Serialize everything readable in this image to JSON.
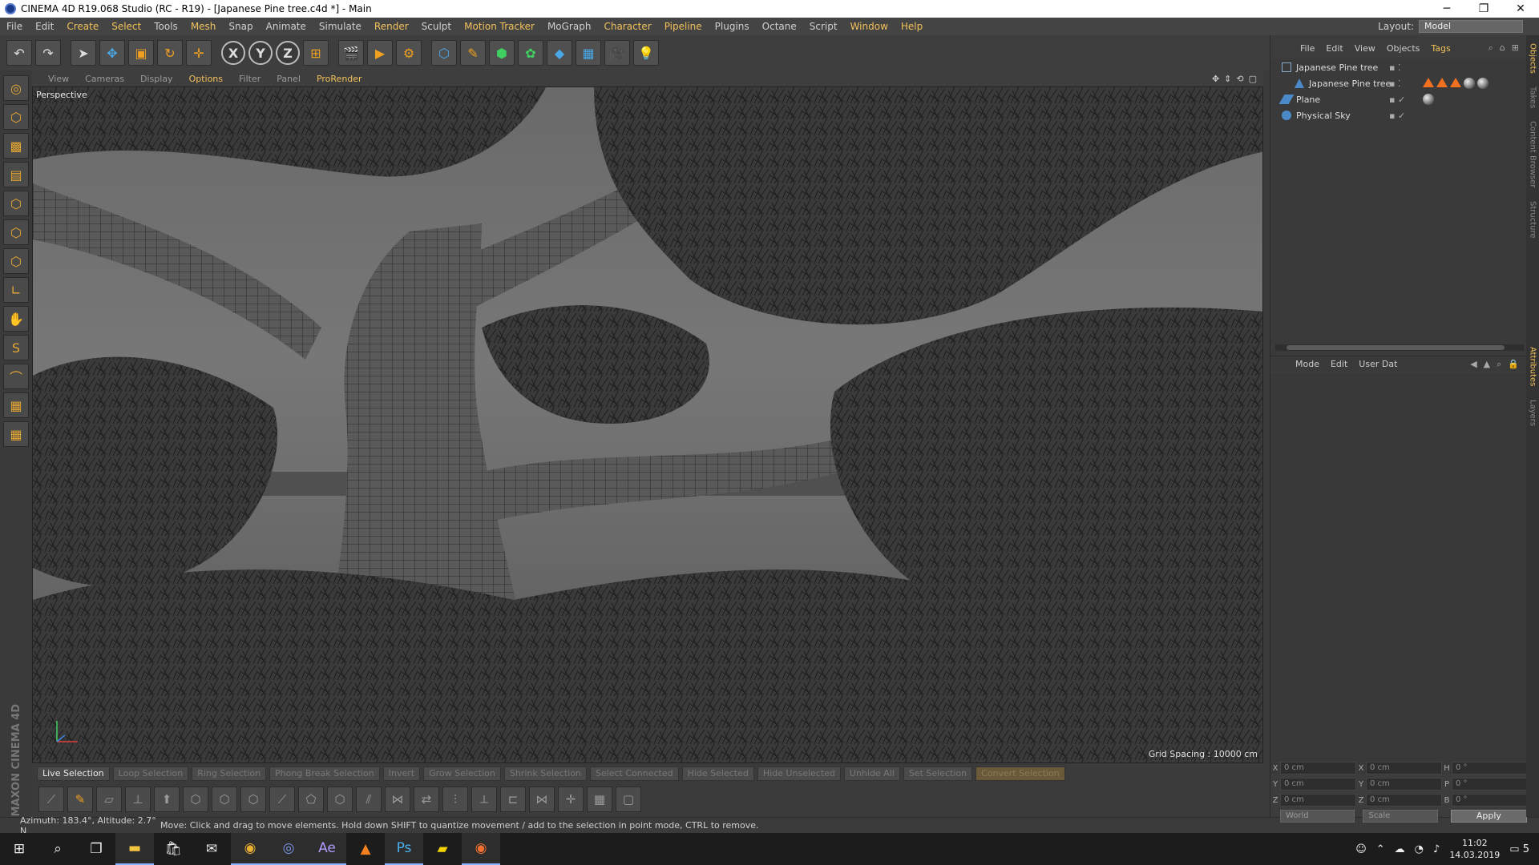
{
  "window": {
    "title": "CINEMA 4D R19.068 Studio (RC - R19) - [Japanese Pine tree.c4d *] - Main",
    "min": "─",
    "max": "❐",
    "close": "✕"
  },
  "menu": {
    "items": [
      "File",
      "Edit",
      "Create",
      "Select",
      "Tools",
      "Mesh",
      "Snap",
      "Animate",
      "Simulate",
      "Render",
      "Sculpt",
      "Motion Tracker",
      "MoGraph",
      "Character",
      "Pipeline",
      "Plugins",
      "Octane",
      "Script",
      "Window",
      "Help"
    ],
    "highlighted": [
      "Create",
      "Select",
      "Mesh",
      "Render",
      "Motion Tracker",
      "Character",
      "Pipeline",
      "Window",
      "Help"
    ],
    "layout_label": "Layout:",
    "layout_value": "Model"
  },
  "viewport": {
    "menu": [
      "View",
      "Cameras",
      "Display",
      "Options",
      "Filter",
      "Panel",
      "ProRender"
    ],
    "highlighted": [
      "Options",
      "ProRender"
    ],
    "camera_label": "Perspective",
    "grid_spacing": "Grid Spacing : 10000 cm"
  },
  "selection_bar": [
    "Live Selection",
    "Loop Selection",
    "Ring Selection",
    "Phong Break Selection",
    "Invert",
    "Grow Selection",
    "Shrink Selection",
    "Select Connected",
    "Hide Selected",
    "Hide Unselected",
    "Unhide All",
    "Set Selection",
    "Convert Selection"
  ],
  "status": {
    "azimuth": "Azimuth: 183.4°, Altitude: 2.7°  N",
    "message": "Move: Click and drag to move elements. Hold down SHIFT to quantize movement / add to the selection in point mode, CTRL to remove."
  },
  "object_manager": {
    "menu": [
      "File",
      "Edit",
      "View",
      "Objects",
      "Tags"
    ],
    "highlighted": [
      "Tags"
    ],
    "objects": [
      {
        "name": "Japanese Pine tree",
        "indent": 0,
        "icon": "null-icon",
        "tags": []
      },
      {
        "name": "Japanese Pine tree",
        "indent": 1,
        "icon": "mesh-icon",
        "tags": [
          "tri",
          "tri",
          "tri",
          "ball",
          "ball"
        ]
      },
      {
        "name": "Plane",
        "indent": 0,
        "icon": "plane-icon",
        "tags": [
          "ball"
        ]
      },
      {
        "name": "Physical Sky",
        "indent": 0,
        "icon": "sky-icon",
        "tags": []
      }
    ]
  },
  "attributes": {
    "menu": [
      "Mode",
      "Edit",
      "User Dat"
    ]
  },
  "coordinates": {
    "rows": [
      {
        "a": "X",
        "av": "0 cm",
        "b": "X",
        "bv": "0 cm",
        "c": "H",
        "cv": "0 °"
      },
      {
        "a": "Y",
        "av": "0 cm",
        "b": "Y",
        "bv": "0 cm",
        "c": "P",
        "cv": "0 °"
      },
      {
        "a": "Z",
        "av": "0 cm",
        "b": "Z",
        "bv": "0 cm",
        "c": "B",
        "cv": "0 °"
      }
    ],
    "world": "World",
    "scale": "Scale",
    "apply": "Apply"
  },
  "side_tabs": [
    "Objects",
    "Takes",
    "Content Browser",
    "Structure",
    "Attributes",
    "Layers"
  ],
  "brand": "MAXON CINEMA 4D",
  "taskbar": {
    "time": "11:02",
    "date": "14.03.2019",
    "notify": "5"
  }
}
